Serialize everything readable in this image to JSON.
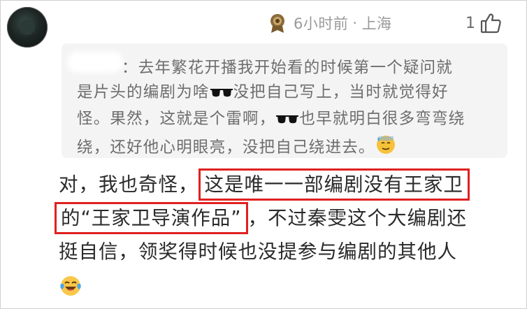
{
  "comment": {
    "meta": {
      "time": "6小时前",
      "separator": "·",
      "location": "上海"
    },
    "likes": {
      "count": "1"
    },
    "quote": {
      "text_a": "：去年繁花开播我开始看的时候第一个疑问就",
      "text_b": "是片头的编剧为啥",
      "text_c": "没把自己写上，当时就觉得好",
      "text_d": "怪。果然，这就是个雷啊，",
      "text_e": "也早就明白很多弯弯绕",
      "text_f": "绕，还好他心明眼亮，没把自己绕进去。"
    },
    "reply": {
      "line1_a": "对，我也奇怪，",
      "line1_b": "这是唯一一部编剧没有王家卫",
      "line2_a": "的“王家卫导演作品”",
      "line2_b": "，不过秦雯这个大编剧还",
      "line3": "挺自信，领奖得时候也没提参与编剧的其他人"
    },
    "colors": {
      "highlight": "#e02020",
      "quote_bg": "#f4f4f5",
      "meta_text": "#9a9a9a"
    }
  }
}
